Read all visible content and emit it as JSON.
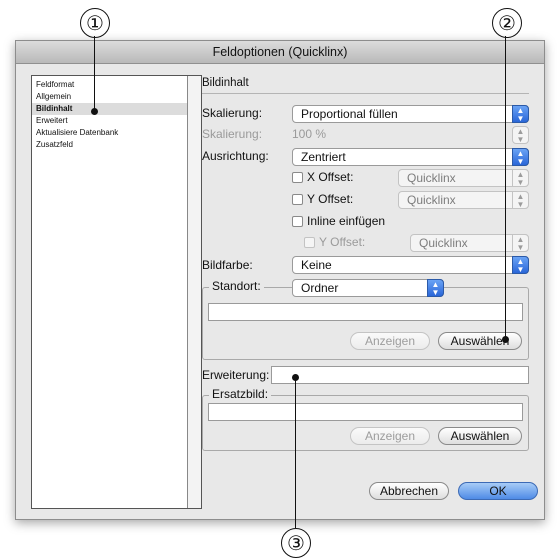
{
  "callouts": {
    "c1": "①",
    "c2": "②",
    "c3": "③"
  },
  "dialog": {
    "title": "Feldoptionen (Quicklinx)"
  },
  "sidebar": {
    "items": [
      {
        "label": "Feldformat"
      },
      {
        "label": "Allgemein"
      },
      {
        "label": "Bildinhalt",
        "selected": true
      },
      {
        "label": "Erweitert"
      },
      {
        "label": "Aktualisiere Datenbank"
      },
      {
        "label": "Zusatzfeld"
      }
    ]
  },
  "main": {
    "section_title": "Bildinhalt",
    "scaling_label": "Skalierung:",
    "scaling_value": "Proportional füllen",
    "scaling2_label": "Skalierung:",
    "scaling2_value": "100 %",
    "alignment_label": "Ausrichtung:",
    "alignment_value": "Zentriert",
    "x_offset_label": "X Offset:",
    "x_offset_value": "Quicklinx",
    "y_offset_label": "Y Offset:",
    "y_offset_value": "Quicklinx",
    "inline_label": "Inline einfügen",
    "y_offset2_label": "Y Offset:",
    "y_offset2_value": "Quicklinx",
    "color_label": "Bildfarbe:",
    "color_value": "Keine",
    "location_group": "Standort:",
    "location_value": "Ordner",
    "location_path": "",
    "show_label": "Anzeigen",
    "choose_label": "Auswählen",
    "extension_label": "Erweiterung:",
    "extension_value": "",
    "replacement_group": "Ersatzbild:",
    "replacement_path": "",
    "show2_label": "Anzeigen",
    "choose2_label": "Auswählen"
  },
  "footer": {
    "cancel_label": "Abbrechen",
    "ok_label": "OK"
  },
  "colors": {
    "accent": "#3d7be0",
    "dialog_bg": "#e8e8e8"
  },
  "icons": {
    "popup_arrows": "up-down-chevron-icon"
  }
}
